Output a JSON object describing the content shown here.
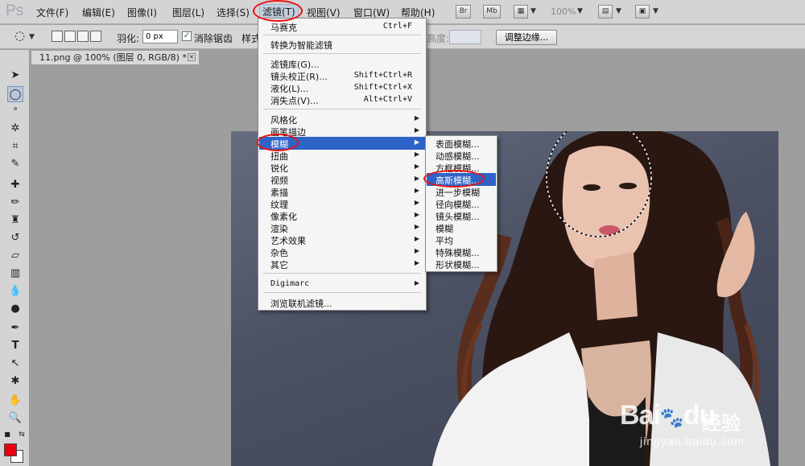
{
  "app": {
    "logo": "Ps"
  },
  "menubar": {
    "items": [
      "文件(F)",
      "编辑(E)",
      "图像(I)",
      "图层(L)",
      "选择(S)",
      "滤镜(T)",
      "视图(V)",
      "窗口(W)",
      "帮助(H)"
    ],
    "buttons": [
      "Br",
      "Mb"
    ],
    "zoom": "100%"
  },
  "options": {
    "feather_label": "羽化:",
    "feather_value": "0 px",
    "antialias_label": "消除锯齿",
    "antialias_checked": true,
    "style_label": "样式",
    "height_label": "高度:",
    "refine_edge": "调整边缘..."
  },
  "document": {
    "tab_title": "11.png @ 100% (图层 0, RGB/8) *",
    "close": "×"
  },
  "filter_menu": {
    "items": [
      {
        "label": "马赛克",
        "shortcut": "Ctrl+F"
      },
      {
        "label": "转换为智能滤镜"
      },
      {
        "label": "滤镜库(G)..."
      },
      {
        "label": "镜头校正(R)...",
        "shortcut": "Shift+Ctrl+R"
      },
      {
        "label": "液化(L)...",
        "shortcut": "Shift+Ctrl+X"
      },
      {
        "label": "消失点(V)...",
        "shortcut": "Alt+Ctrl+V"
      },
      {
        "label": "风格化"
      },
      {
        "label": "画笔描边"
      },
      {
        "label": "模糊"
      },
      {
        "label": "扭曲"
      },
      {
        "label": "锐化"
      },
      {
        "label": "视频"
      },
      {
        "label": "素描"
      },
      {
        "label": "纹理"
      },
      {
        "label": "像素化"
      },
      {
        "label": "渲染"
      },
      {
        "label": "艺术效果"
      },
      {
        "label": "杂色"
      },
      {
        "label": "其它"
      },
      {
        "label": "Digimarc"
      },
      {
        "label": "浏览联机滤镜..."
      }
    ]
  },
  "blur_submenu": {
    "items": [
      "表面模糊...",
      "动感模糊...",
      "方框模糊...",
      "高斯模糊...",
      "进一步模糊",
      "径向模糊...",
      "镜头模糊...",
      "模糊",
      "平均",
      "特殊模糊...",
      "形状模糊..."
    ]
  },
  "watermark": {
    "logo": "Bai",
    "logo_rest": "du",
    "jingyan": "经验",
    "url": "jingyan.baidu.com"
  },
  "colors": {
    "foreground": "#e8000f",
    "background": "#ffffff",
    "highlight": "#2e63c8",
    "annotation": "#e11111"
  }
}
